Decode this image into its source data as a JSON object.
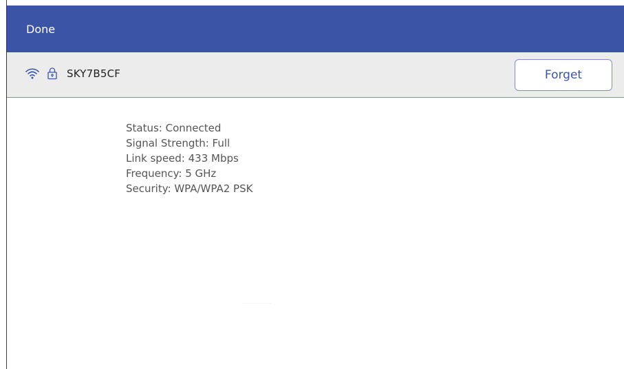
{
  "header": {
    "done_label": "Done"
  },
  "network": {
    "name": "SKY7B5CF",
    "forget_label": "Forget",
    "icons": [
      "wifi-icon",
      "lock-icon"
    ]
  },
  "details": {
    "status": "Status: Connected",
    "signal_strength": "Signal Strength: Full",
    "link_speed": "Link speed: 433 Mbps",
    "frequency": "Frequency: 5 GHz",
    "security": "Security: WPA/WPA2 PSK"
  },
  "colors": {
    "header_bg": "#3b54a5",
    "network_bar_bg": "#ececec",
    "accent": "#3b54a5",
    "text": "#555555"
  }
}
